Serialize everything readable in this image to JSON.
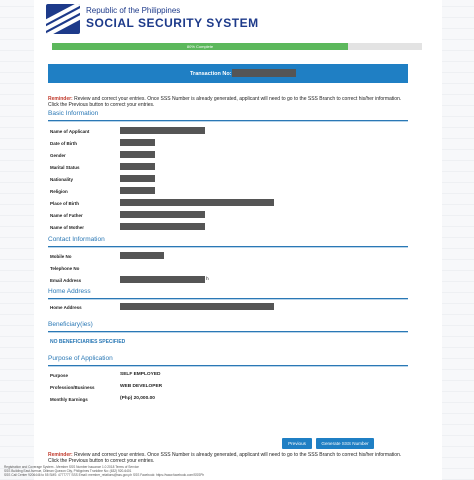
{
  "header": {
    "subtitle": "Republic of the Philippines",
    "title": "SOCIAL SECURITY SYSTEM"
  },
  "progress": {
    "label": "80% Complete",
    "percent": 80
  },
  "transaction": {
    "label": "Transaction No:"
  },
  "reminder": {
    "prefix": "Reminder:",
    "text": " Review and correct your entries. Once SSS Number is already generated, applicant will need to go to the SSS Branch to correct his/her information. Click the Previous button to correct your entries."
  },
  "basic": {
    "title": "Basic Information",
    "fields": [
      "Name of Applicant",
      "Date of Birth",
      "Gender",
      "Marital Status",
      "Nationality",
      "Religion",
      "Place of Birth",
      "Name of Father",
      "Name of Mother"
    ]
  },
  "contact": {
    "title": "Contact Information",
    "fields": [
      "Mobile No",
      "Telephone No",
      "Email Address"
    ],
    "email_tail": "h"
  },
  "home": {
    "title": "Home Address",
    "field": "Home Address"
  },
  "beneficiary": {
    "title": "Beneficiary(ies)",
    "none_text": "NO BENEFICIARIES SPECIFIED"
  },
  "purpose": {
    "title": "Purpose of Application",
    "rows": [
      {
        "label": "Purpose",
        "value": "SELF EMPLOYED"
      },
      {
        "label": "Profession/Business",
        "value": "WEB DEVELOPER"
      },
      {
        "label": "Monthly Earnings",
        "value": "(Php) 20,000.00"
      }
    ]
  },
  "buttons": {
    "previous": "Previous",
    "generate": "Generate SSS Number"
  },
  "footer": {
    "line1": "Registration and Coverage System - Member SSS Number Issuance 1.0 2018 Terms of Service",
    "line2": "SSS Building East Avenue, Diliman Quezon City, Philippines Trunkline No: (632) 920-6401",
    "line3": "SSS Call Center 9206446 to 55 SMS: 4777777 SSS Email: member_relations@sss.gov.ph SSS Facebook: https://www.facebook.com/SSSPh"
  },
  "colors": {
    "brand": "#1d3a8a",
    "accent": "#1f7fc4",
    "success": "#5cb85c",
    "reminder": "#c0392b"
  }
}
